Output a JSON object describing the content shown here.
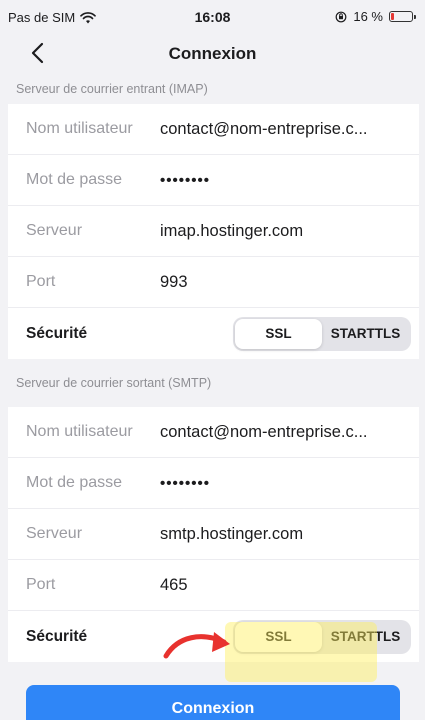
{
  "status_bar": {
    "carrier": "Pas de SIM",
    "time": "16:08",
    "battery_text": "16 %",
    "battery_level": 0.16,
    "battery_color": "#e53935"
  },
  "nav": {
    "back_icon": "chevron-left-icon",
    "title": "Connexion"
  },
  "imap": {
    "header": "Serveur de courrier entrant (IMAP)",
    "username_label": "Nom utilisateur",
    "username_value": "contact@nom-entreprise.c...",
    "password_label": "Mot de passe",
    "password_value": "••••••••",
    "server_label": "Serveur",
    "server_value": "imap.hostinger.com",
    "port_label": "Port",
    "port_value": "993",
    "security_label": "Sécurité",
    "security_options": [
      "SSL",
      "STARTTLS"
    ],
    "security_selected": "SSL"
  },
  "smtp": {
    "header": "Serveur de courrier sortant (SMTP)",
    "username_label": "Nom utilisateur",
    "username_value": "contact@nom-entreprise.c...",
    "password_label": "Mot de passe",
    "password_value": "••••••••",
    "server_label": "Serveur",
    "server_value": "smtp.hostinger.com",
    "port_label": "Port",
    "port_value": "465",
    "security_label": "Sécurité",
    "security_options": [
      "SSL",
      "STARTTLS"
    ],
    "security_selected": "SSL"
  },
  "actions": {
    "connect_label": "Connexion"
  },
  "colors": {
    "accent": "#2f86f7",
    "annotation_arrow": "#e8322e",
    "annotation_highlight": "#fff05a"
  }
}
